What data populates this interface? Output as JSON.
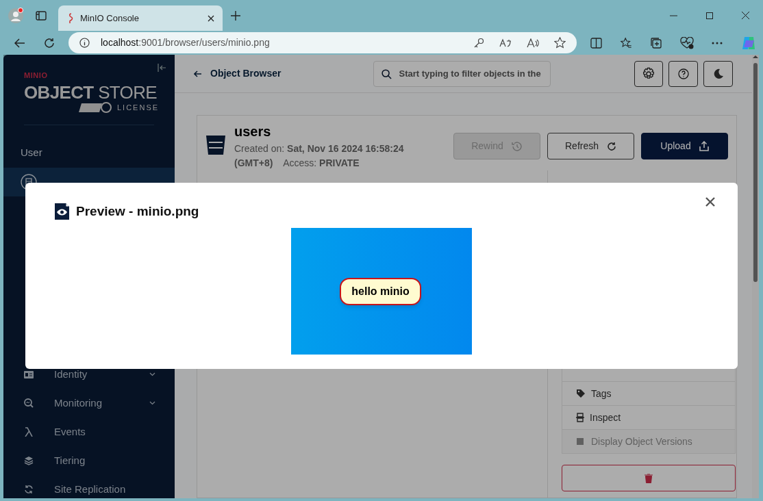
{
  "browser": {
    "tab_title": "MinIO Console",
    "url_host": "localhost",
    "url_path": ":9001/browser/users/minio.png"
  },
  "sidebar": {
    "logo_mark": "MINIO",
    "logo_bold": "OBJECT",
    "logo_light": "STORE",
    "license": "LICENSE",
    "section": "User",
    "items": [
      {
        "selected": true,
        "expandable": false
      },
      {
        "label": "Identity",
        "selected": false,
        "expandable": true
      },
      {
        "label": "Monitoring",
        "selected": false,
        "expandable": true
      },
      {
        "label": "Events",
        "selected": false,
        "expandable": false
      },
      {
        "label": "Tiering",
        "selected": false,
        "expandable": false
      },
      {
        "label": "Site Replication",
        "selected": false,
        "expandable": false
      }
    ]
  },
  "header": {
    "back_label": "Object Browser",
    "search": {
      "placeholder": "Start typing to filter objects in the"
    }
  },
  "bucket": {
    "name": "users",
    "created_label": "Created on:",
    "created_value": "Sat, Nov 16 2024 16:58:24",
    "timezone": "(GMT+8)",
    "access_label": "Access:",
    "access_value": "PRIVATE",
    "buttons": [
      {
        "label": "Rewind",
        "kind": "outline",
        "disabled": true
      },
      {
        "label": "Refresh",
        "kind": "outline",
        "disabled": false
      },
      {
        "label": "Upload",
        "kind": "primary",
        "disabled": false
      }
    ]
  },
  "actions": [
    {
      "label": "Tags",
      "disabled": false
    },
    {
      "label": "Inspect",
      "disabled": false
    },
    {
      "label": "Display Object Versions",
      "disabled": true
    }
  ],
  "modal": {
    "title": "Preview - minio.png",
    "image_text": "hello minio"
  }
}
